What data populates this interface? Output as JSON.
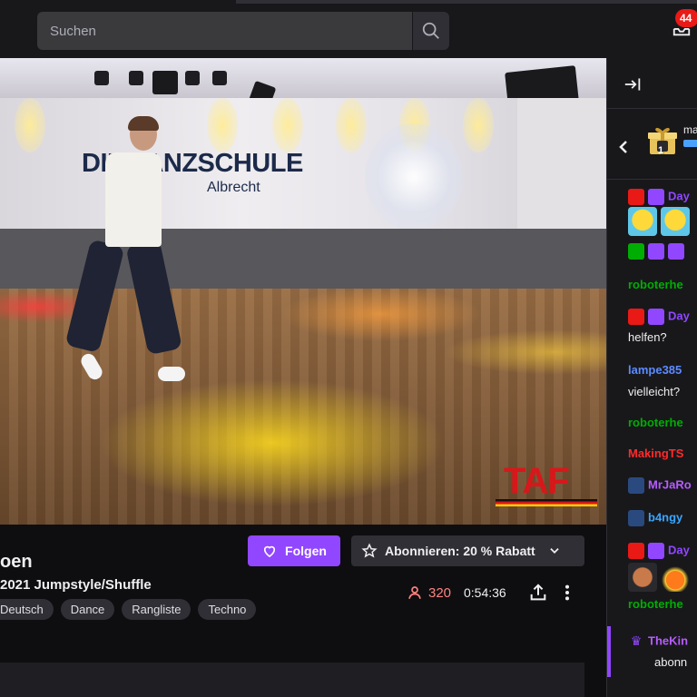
{
  "search": {
    "placeholder": "Suchen"
  },
  "notifications": {
    "count": "44"
  },
  "video": {
    "wall_text": "DIE TANZSCHULE",
    "wall_subtext": "Albrecht",
    "overlay_logo": "TAF"
  },
  "stream": {
    "streamer_name_partial": "oen",
    "title_partial": "2021 Jumpstyle/Shuffle",
    "tags": [
      "Deutsch",
      "Dance",
      "Rangliste",
      "Techno"
    ],
    "viewers": "320",
    "uptime": "0:54:36"
  },
  "actions": {
    "follow_label": "Folgen",
    "subscribe_label": "Abonnieren: 20 % Rabatt"
  },
  "colors": {
    "accent": "#9147ff",
    "live_red": "#e91916",
    "viewer_count": "#ff8280"
  },
  "chat": {
    "gift_user_partial": "ma",
    "gift_count": "1",
    "messages": [
      {
        "user": "Day",
        "user_color": "#9147ff",
        "text": ""
      },
      {
        "user": "roboterhe",
        "user_color": "#00ad03",
        "text": ""
      },
      {
        "user": "Day",
        "user_color": "#9147ff",
        "text": "helfen?"
      },
      {
        "user": "lampe385",
        "user_color": "#5c8bff",
        "text": "vielleicht?"
      },
      {
        "user": "roboterhe",
        "user_color": "#00ad03",
        "text": ""
      },
      {
        "user": "MakingTS",
        "user_color": "#ff2a2a",
        "text": ""
      },
      {
        "user": "MrJaRo",
        "user_color": "#b65cff",
        "text": ""
      },
      {
        "user": "b4ngy",
        "user_color": "#3aa6ff",
        "text": ""
      },
      {
        "user": "Day",
        "user_color": "#9147ff",
        "text": ""
      },
      {
        "user": "roboterhe",
        "user_color": "#00ad03",
        "text": ""
      },
      {
        "user": "TheKin",
        "user_color": "#b65cff",
        "text": "abonn"
      }
    ]
  }
}
